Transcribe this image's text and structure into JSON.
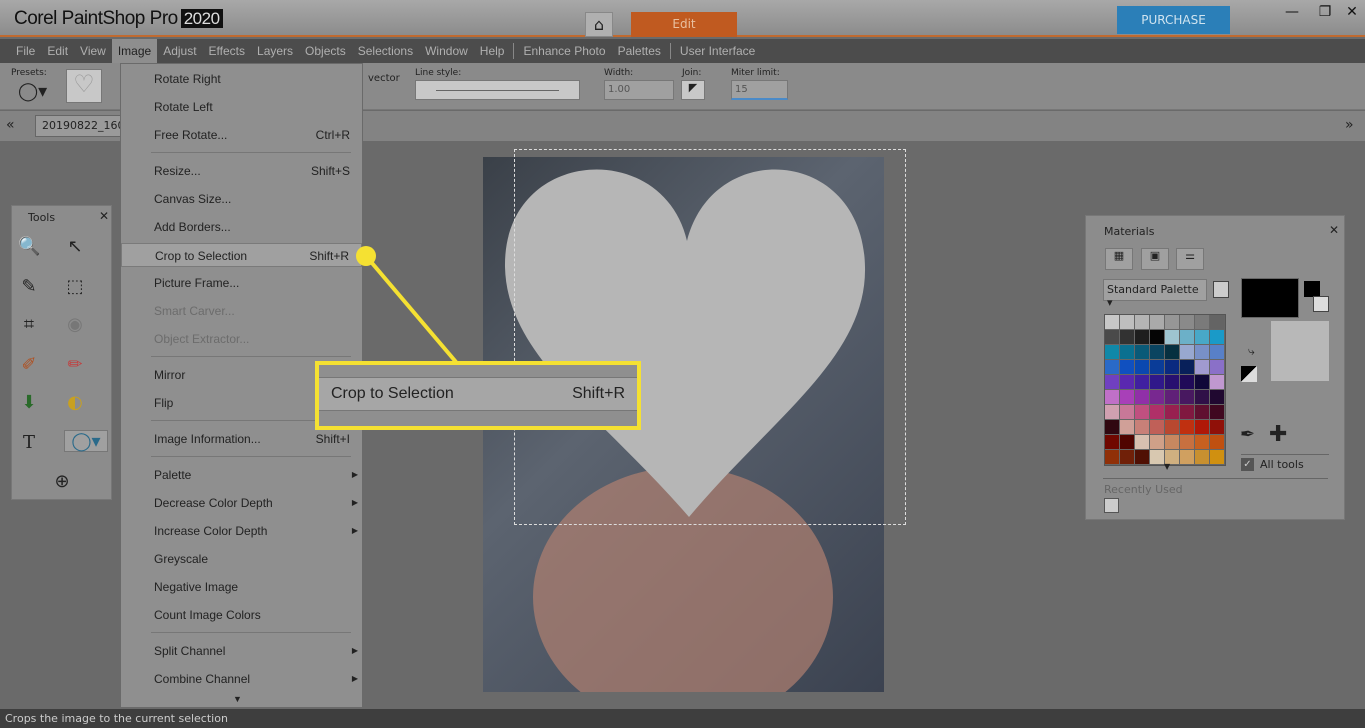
{
  "app": {
    "logo": "Corel PaintShop Pro",
    "year": "2020",
    "edit_tab": "Edit",
    "purchase": "PURCHASE",
    "home_icon": "home-icon"
  },
  "menubar": [
    "File",
    "Edit",
    "View",
    "Image",
    "Adjust",
    "Effects",
    "Layers",
    "Objects",
    "Selections",
    "Window",
    "Help",
    "Enhance Photo",
    "Palettes",
    "User Interface"
  ],
  "options": {
    "presets": "Presets:",
    "vector": "vector",
    "line_style": "Line style:",
    "width_label": "Width:",
    "width_value": "1.00",
    "join_label": "Join:",
    "miter_label": "Miter limit:",
    "miter_value": "15"
  },
  "document_tab": "20190822_160036",
  "tools_panel": {
    "title": "Tools"
  },
  "image_menu": [
    {
      "label": "Rotate Right",
      "shortcut": ""
    },
    {
      "label": "Rotate Left",
      "shortcut": ""
    },
    {
      "label": "Free Rotate...",
      "shortcut": "Ctrl+R"
    },
    {
      "sep": true
    },
    {
      "label": "Resize...",
      "shortcut": "Shift+S"
    },
    {
      "label": "Canvas Size...",
      "shortcut": ""
    },
    {
      "label": "Add Borders...",
      "shortcut": ""
    },
    {
      "label": "Crop to Selection",
      "shortcut": "Shift+R",
      "highlight": true
    },
    {
      "label": "Picture Frame...",
      "shortcut": ""
    },
    {
      "label": "Smart Carver...",
      "shortcut": "",
      "disabled": true
    },
    {
      "label": "Object Extractor...",
      "shortcut": "",
      "disabled": true
    },
    {
      "sep": true
    },
    {
      "label": "Mirror",
      "shortcut": ""
    },
    {
      "label": "Flip",
      "shortcut": ""
    },
    {
      "sep": true
    },
    {
      "label": "Image Information...",
      "shortcut": "Shift+I"
    },
    {
      "sep": true
    },
    {
      "label": "Palette",
      "shortcut": "",
      "submenu": true
    },
    {
      "label": "Decrease Color Depth",
      "shortcut": "",
      "submenu": true
    },
    {
      "label": "Increase Color Depth",
      "shortcut": "",
      "submenu": true
    },
    {
      "label": "Greyscale",
      "shortcut": ""
    },
    {
      "label": "Negative Image",
      "shortcut": ""
    },
    {
      "label": "Count Image Colors",
      "shortcut": ""
    },
    {
      "sep": true
    },
    {
      "label": "Split Channel",
      "shortcut": "",
      "submenu": true
    },
    {
      "label": "Combine Channel",
      "shortcut": "",
      "submenu": true
    }
  ],
  "callout": {
    "label": "Crop to Selection",
    "shortcut": "Shift+R",
    "color": "#f5e132"
  },
  "materials": {
    "title": "Materials",
    "palette_select": "Standard Palette",
    "all_tools": "All tools",
    "all_tools_checked": true,
    "recently_used": "Recently Used",
    "swatches": [
      "#c8c8c8",
      "#bebebe",
      "#b4b4b4",
      "#aaaaaa",
      "#969696",
      "#8a8a8a",
      "#7a7a7a",
      "#646464",
      "#4a4a4a",
      "#323232",
      "#1e1e1e",
      "#050505",
      "#9ec4d0",
      "#6cb0c8",
      "#48a8c8",
      "#1a9ac8",
      "#1088a8",
      "#0a7090",
      "#0a5a78",
      "#0a4460",
      "#063040",
      "#98a8d0",
      "#7890c8",
      "#5880c8",
      "#2a6ac8",
      "#1050c0",
      "#0a48b0",
      "#0a3c98",
      "#0a2a80",
      "#08205a",
      "#a09ad0",
      "#8a70c8",
      "#7040c0",
      "#5a28b0",
      "#4020a0",
      "#30188a",
      "#281070",
      "#200a58",
      "#100838",
      "#c098d0",
      "#c070c8",
      "#a840b8",
      "#9030a8",
      "#782890",
      "#602078",
      "#481860",
      "#301048",
      "#200830",
      "#d0a0b0",
      "#c87898",
      "#c05080",
      "#b03068",
      "#982050",
      "#801840",
      "#601030",
      "#400820",
      "#300810",
      "#d0a098",
      "#c88078",
      "#c06058",
      "#b84830",
      "#c03010",
      "#b01808",
      "#901008",
      "#700800",
      "#500400",
      "#d8c0b0",
      "#d0a088",
      "#c88860",
      "#c87040",
      "#c86020",
      "#c05010",
      "#903008",
      "#702008",
      "#501004",
      "#d8c8b0",
      "#d0b080",
      "#d0a060",
      "#c89030",
      "#d09010"
    ]
  },
  "status": "Crops the image to the current selection"
}
